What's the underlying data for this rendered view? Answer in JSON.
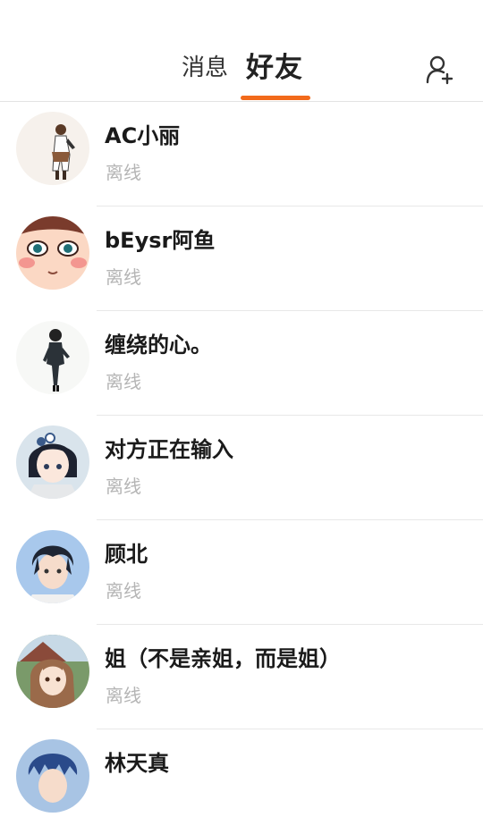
{
  "header": {
    "tabs": [
      {
        "label": "消息",
        "active": false
      },
      {
        "label": "好友",
        "active": true
      }
    ],
    "accent_color": "#f26a1b",
    "add_friend_icon": "add-user-icon"
  },
  "friends": [
    {
      "name": "AC小丽",
      "status": "离线"
    },
    {
      "name": "bEysr阿鱼",
      "status": "离线"
    },
    {
      "name": "缠绕的心。",
      "status": "离线"
    },
    {
      "name": "对方正在输入",
      "status": "离线"
    },
    {
      "name": "顾北",
      "status": "离线"
    },
    {
      "name": "姐（不是亲姐，而是姐）",
      "status": "离线"
    },
    {
      "name": "林天真",
      "status": ""
    }
  ]
}
